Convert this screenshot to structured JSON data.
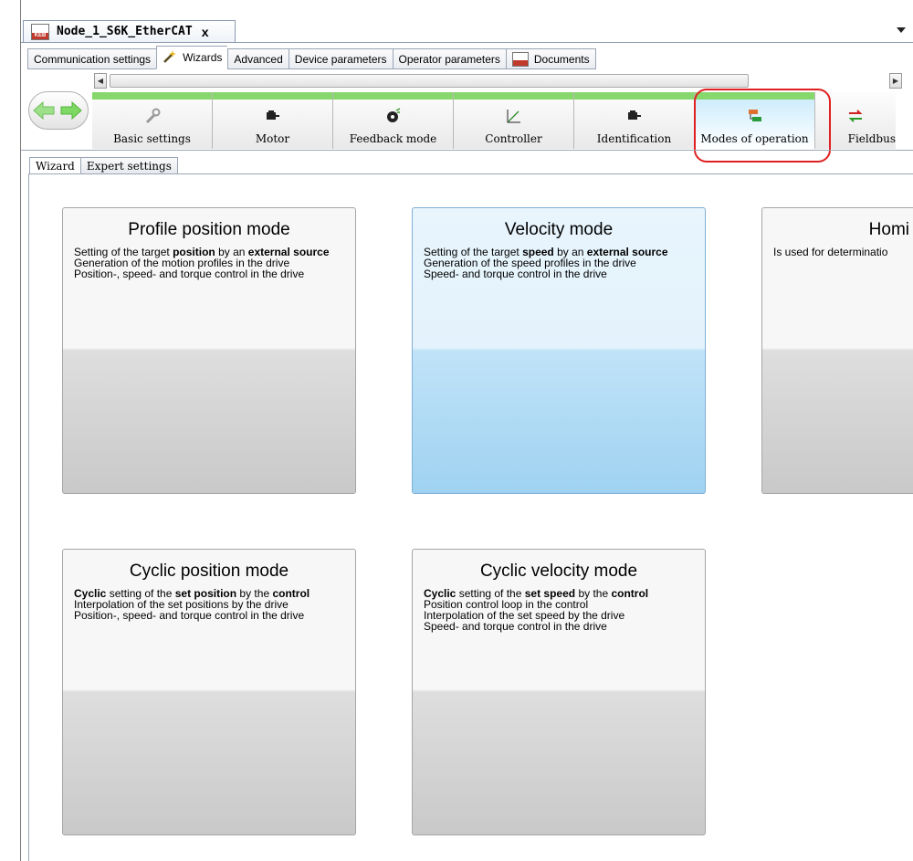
{
  "document": {
    "title": "Node_1_S6K_EtherCAT",
    "close": "x"
  },
  "editor_tabs": [
    {
      "label": "Communication settings"
    },
    {
      "label": "Wizards"
    },
    {
      "label": "Advanced"
    },
    {
      "label": "Device parameters"
    },
    {
      "label": "Operator parameters"
    },
    {
      "label": "Documents"
    }
  ],
  "wizard_steps": [
    {
      "label": "Basic settings",
      "icon": "wrench-icon"
    },
    {
      "label": "Motor",
      "icon": "motor-icon"
    },
    {
      "label": "Feedback mode",
      "icon": "encoder-icon"
    },
    {
      "label": "Controller",
      "icon": "curve-icon"
    },
    {
      "label": "Identification",
      "icon": "motor-icon"
    },
    {
      "label": "Modes of operation",
      "icon": "modes-icon"
    },
    {
      "label": "Fieldbus",
      "icon": "exchange-icon"
    }
  ],
  "sub_tabs": [
    {
      "label": "Wizard"
    },
    {
      "label": "Expert settings"
    }
  ],
  "modes": {
    "profile_position": {
      "title": "Profile position mode",
      "l1a": "Setting of the target ",
      "l1b": "position",
      "l1c": " by an ",
      "l1d": "external source",
      "l2": "Generation of the motion profiles in the drive",
      "l3": "Position-, speed- and torque control in the drive"
    },
    "velocity": {
      "title": "Velocity mode",
      "l1a": "Setting of the target ",
      "l1b": "speed",
      "l1c": " by an ",
      "l1d": "external source",
      "l2": "Generation of the speed profiles in the drive",
      "l3": "Speed- and torque control in the drive"
    },
    "homing": {
      "title": "Homi",
      "l1": "Is used for determinatio"
    },
    "cyclic_position": {
      "title": "Cyclic position mode",
      "l1a": "Cyclic",
      "l1b": " setting of the ",
      "l1c": "set position",
      "l1d": " by the ",
      "l1e": "control",
      "l2": "Interpolation of the set positions by the drive",
      "l3": "Position-, speed- and torque control in the drive"
    },
    "cyclic_velocity": {
      "title": "Cyclic velocity mode",
      "l1a": "Cyclic",
      "l1b": " setting of the ",
      "l1c": "set speed",
      "l1d": " by the ",
      "l1e": "control",
      "l2": "Position control loop in the control",
      "l3": "Interpolation of the set speed by the drive",
      "l4": "Speed- and torque control in the drive"
    }
  },
  "colors": {
    "step_progress": "#86d86c",
    "highlight": "#e02020",
    "selected_card": "#c0e3f8"
  }
}
